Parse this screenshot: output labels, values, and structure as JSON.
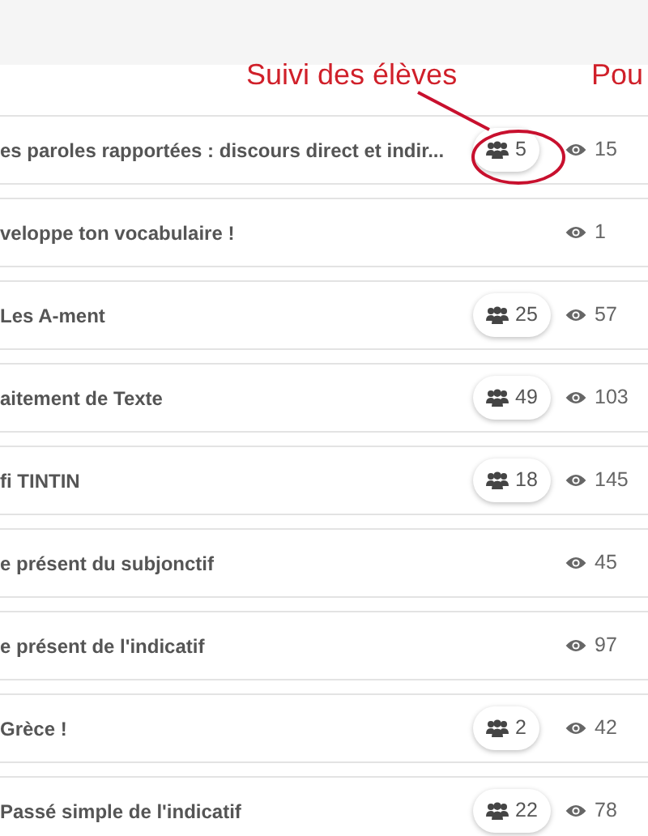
{
  "annotations": [
    {
      "text": "Suivi des élèves"
    },
    {
      "text": "Pou"
    }
  ],
  "rows": [
    {
      "title": "es paroles rapportées : discours direct et indir...",
      "students": "5",
      "views": "15",
      "highlighted": true
    },
    {
      "title": "veloppe ton vocabulaire !",
      "views": "1",
      "highlighted": false
    },
    {
      "title": "Les A-ment",
      "students": "25",
      "views": "57",
      "highlighted": false
    },
    {
      "title": "aitement de Texte",
      "students": "49",
      "views": "103",
      "highlighted": false
    },
    {
      "title": "fi TINTIN",
      "students": "18",
      "views": "145",
      "highlighted": false
    },
    {
      "title": "e présent du subjonctif",
      "views": "45",
      "highlighted": false
    },
    {
      "title": "e présent de l'indicatif",
      "views": "97",
      "highlighted": false
    },
    {
      "title": "Grèce !",
      "students": "2",
      "views": "42",
      "highlighted": false
    },
    {
      "title": "Passé simple de l'indicatif",
      "students": "22",
      "views": "78",
      "highlighted": false
    }
  ]
}
